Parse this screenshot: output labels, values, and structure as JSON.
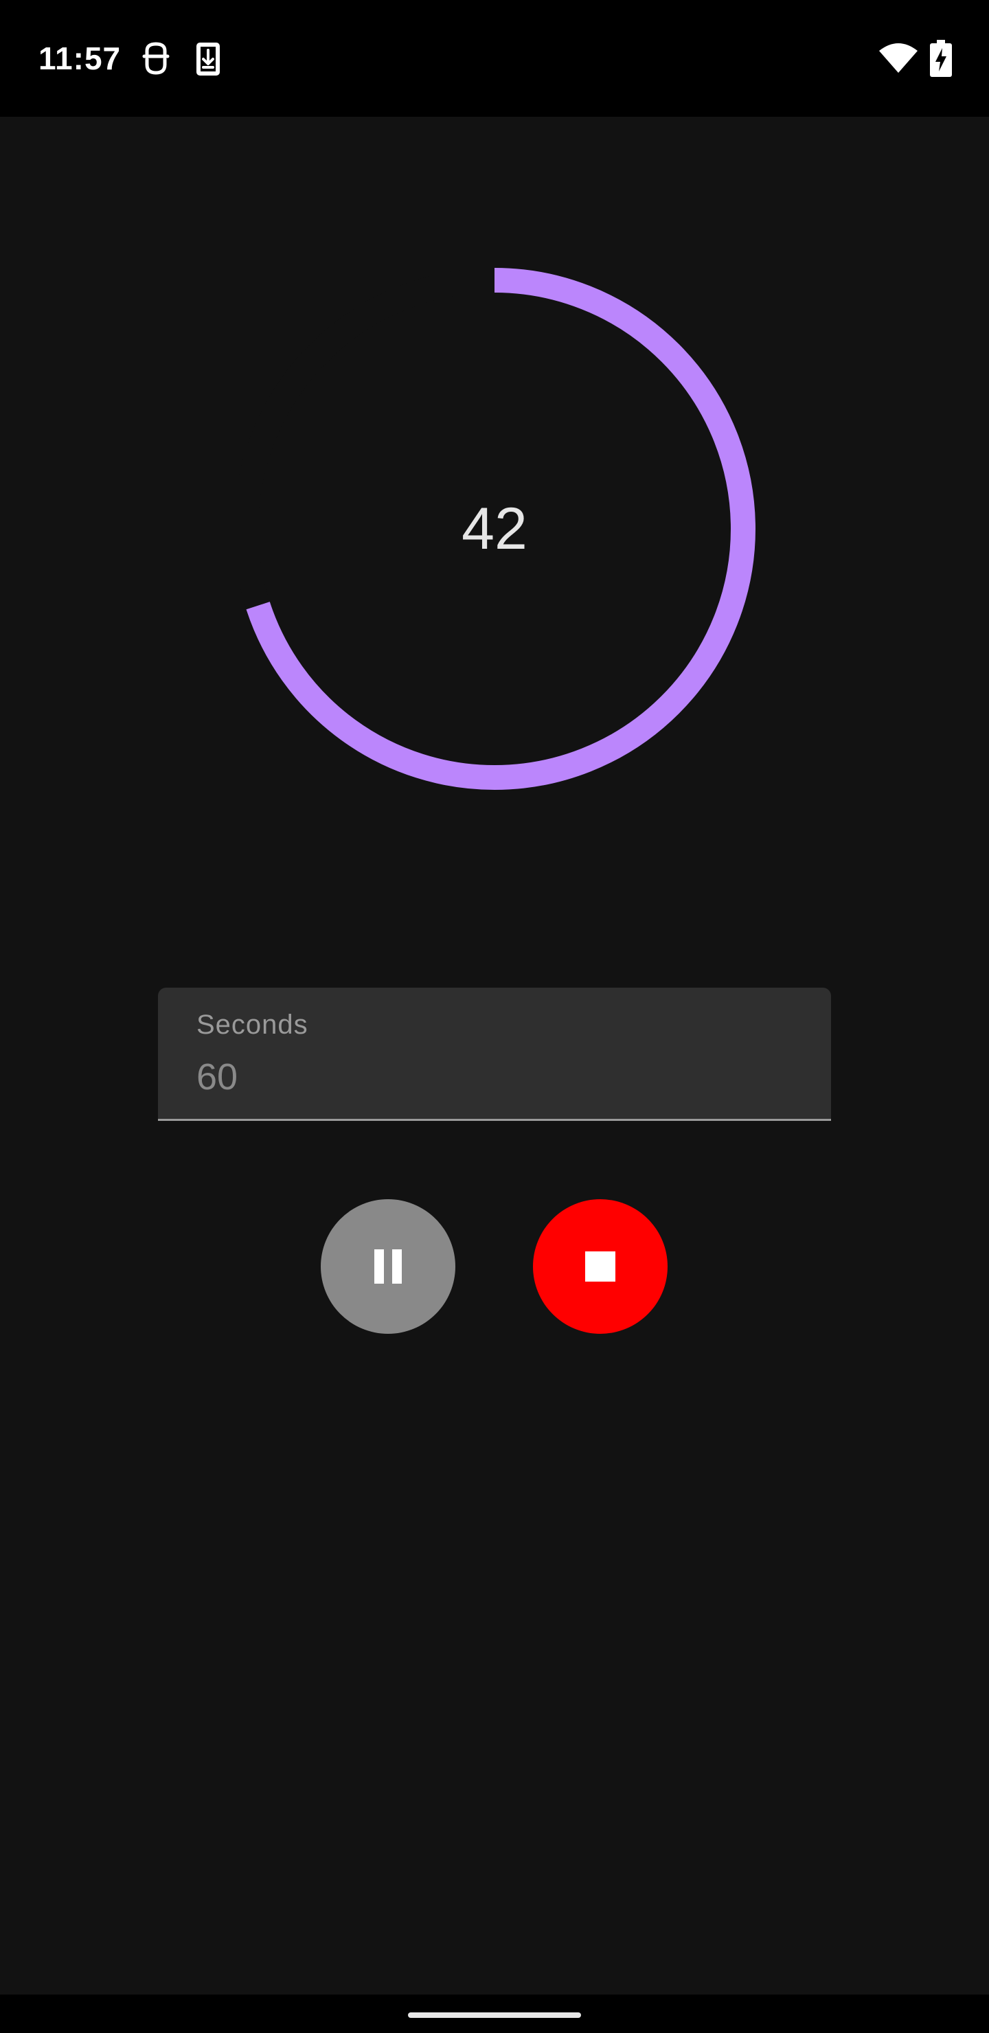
{
  "status_bar": {
    "time": "11:57",
    "left_icons": [
      "notification-face-icon",
      "download-icon"
    ],
    "right_icons": [
      "wifi-icon",
      "battery-charging-icon"
    ]
  },
  "timer": {
    "display_value": "42",
    "total_seconds": 60,
    "remaining_seconds": 42,
    "progress_fraction": 0.7,
    "progress_color": "#BB86FC"
  },
  "seconds_field": {
    "label": "Seconds",
    "value": "60"
  },
  "controls": {
    "pause_button": {
      "icon": "pause-icon",
      "color": "#898989"
    },
    "stop_button": {
      "icon": "stop-icon",
      "color": "#FF0000"
    }
  },
  "theme": {
    "background": "#121212",
    "accent": "#BB86FC"
  }
}
